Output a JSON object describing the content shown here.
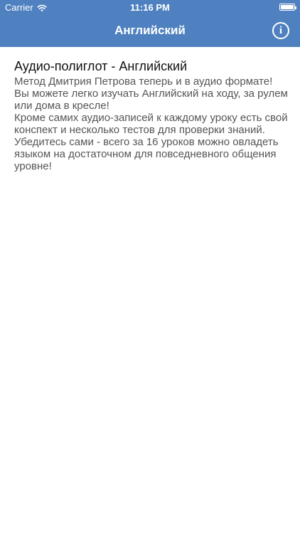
{
  "status_bar": {
    "carrier": "Carrier",
    "time": "11:16 PM",
    "wifi_icon": "wifi-icon",
    "battery_icon": "battery-icon",
    "battery_level": 1.0
  },
  "nav": {
    "title": "Английский",
    "info_icon": "info-icon",
    "info_glyph": "i",
    "bar_color": "#4f81c0"
  },
  "content": {
    "title": "Аудио-полиглот - Английский",
    "paragraphs": [
      "Метод Дмитрия Петрова теперь и в аудио формате! Вы можете легко изучать Английский на ходу, за рулем или дома в кресле!",
      "Кроме самих аудио-записей к каждому уроку есть свой конспект и несколько тестов для проверки знаний.",
      "Убедитесь сами - всего за 16 уроков можно овладеть языком на достаточном для повседневного общения уровне!"
    ]
  }
}
